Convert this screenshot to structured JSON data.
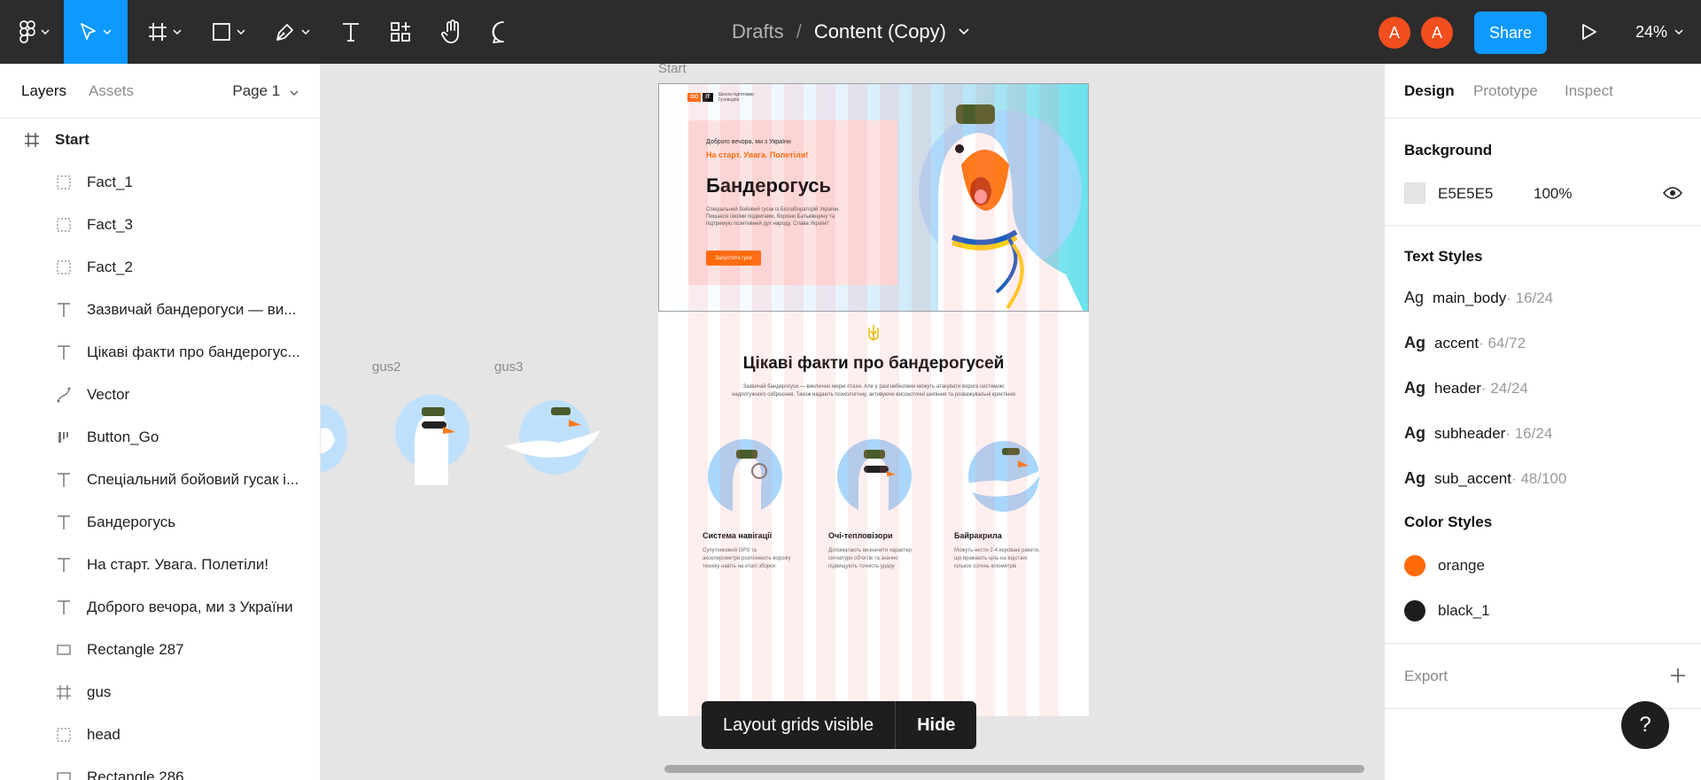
{
  "toolbar": {
    "breadcrumb_drafts": "Drafts",
    "breadcrumb_sep": "/",
    "file_name": "Content (Copy)",
    "avatars": [
      "A",
      "A"
    ],
    "share_label": "Share",
    "zoom": "24%"
  },
  "left_panel": {
    "tab_layers": "Layers",
    "tab_assets": "Assets",
    "page": "Page 1",
    "layers": [
      {
        "icon": "frame-icon",
        "name": "Start"
      },
      {
        "icon": "dashed-frame-icon",
        "name": "Fact_1"
      },
      {
        "icon": "dashed-frame-icon",
        "name": "Fact_3"
      },
      {
        "icon": "dashed-frame-icon",
        "name": "Fact_2"
      },
      {
        "icon": "text-icon",
        "name": "Зазвичай бандерогуси — ви..."
      },
      {
        "icon": "text-icon",
        "name": "Цікаві факти про бандерогус..."
      },
      {
        "icon": "vector-icon",
        "name": "Vector"
      },
      {
        "icon": "component-icon",
        "name": "Button_Go"
      },
      {
        "icon": "text-icon",
        "name": "Спеціальний бойовий гусак і..."
      },
      {
        "icon": "text-icon",
        "name": "Бандерогусь"
      },
      {
        "icon": "text-icon",
        "name": "На старт. Увага. Полетіли!"
      },
      {
        "icon": "text-icon",
        "name": "Доброго вечора, ми з України"
      },
      {
        "icon": "rectangle-icon",
        "name": "Rectangle 287"
      },
      {
        "icon": "frame-icon",
        "name": "gus"
      },
      {
        "icon": "dashed-frame-icon",
        "name": "head"
      },
      {
        "icon": "rectangle-icon",
        "name": "Rectangle 286"
      }
    ]
  },
  "canvas": {
    "frame_start_label": "Start",
    "frame_gus2_label": "gus2",
    "frame_gus3_label": "gus3",
    "hero": {
      "logo_go": "GO",
      "logo_it": "IT",
      "logo_sub": "Школа підготовки Гусеводіїв",
      "greeting": "Доброго вечора, ми з України",
      "accent": "На старт. Увага. Полетіли!",
      "title": "Бандерогусь",
      "text": "Спеціальний бойовий гусак із Біолабораторій України. Пишаєся своїми подвигами, бороню Батьківщину та підтримую позитивний дух народу. Слава Україні!",
      "button": "Запустити гуся"
    },
    "facts": {
      "title": "Цікаві факти про бандерогусей",
      "subtitle": "Зазвичай бандерогуси — виключно мирні птахи. Але у разі небезпеки можуть атакувати ворога системою надпотужного озброєння. Також надають психологічну, активуючи високоточні шипіння та розважувальні кряхтіння",
      "items": [
        {
          "title": "Система навігації",
          "text": "Супутниковий GPS та акселерометри розпізнають ворожу техніку навіть на етапі зборки"
        },
        {
          "title": "Очі-тепловізори",
          "text": "Допомагають визначити характер сигнатури об'єктів та значно підвищують точність удару"
        },
        {
          "title": "Байракрила",
          "text": "Можуть нести 2-4 керовані ракети, що вражають ціль на відстані кількох сотень кілометрів"
        }
      ]
    },
    "toast_message": "Layout grids visible",
    "toast_action": "Hide"
  },
  "right_panel": {
    "tab_design": "Design",
    "tab_prototype": "Prototype",
    "tab_inspect": "Inspect",
    "background_title": "Background",
    "background_hex": "E5E5E5",
    "background_opacity": "100%",
    "text_styles_title": "Text Styles",
    "text_styles": [
      {
        "name": "main_body",
        "meta": " · 16/24"
      },
      {
        "name": "accent",
        "meta": " · 64/72"
      },
      {
        "name": "header",
        "meta": " · 24/24"
      },
      {
        "name": "subheader",
        "meta": " · 16/24"
      },
      {
        "name": "sub_accent",
        "meta": " · 48/100"
      }
    ],
    "color_styles_title": "Color Styles",
    "color_styles": [
      {
        "name": "orange",
        "color": "#ff6b08"
      },
      {
        "name": "black_1",
        "color": "#1e1e1e"
      }
    ],
    "export_title": "Export",
    "help": "?"
  },
  "colors": {
    "accent_blue": "#0d99ff",
    "toolbar_bg": "#2c2c2c",
    "canvas_bg": "#e5e5e5"
  }
}
